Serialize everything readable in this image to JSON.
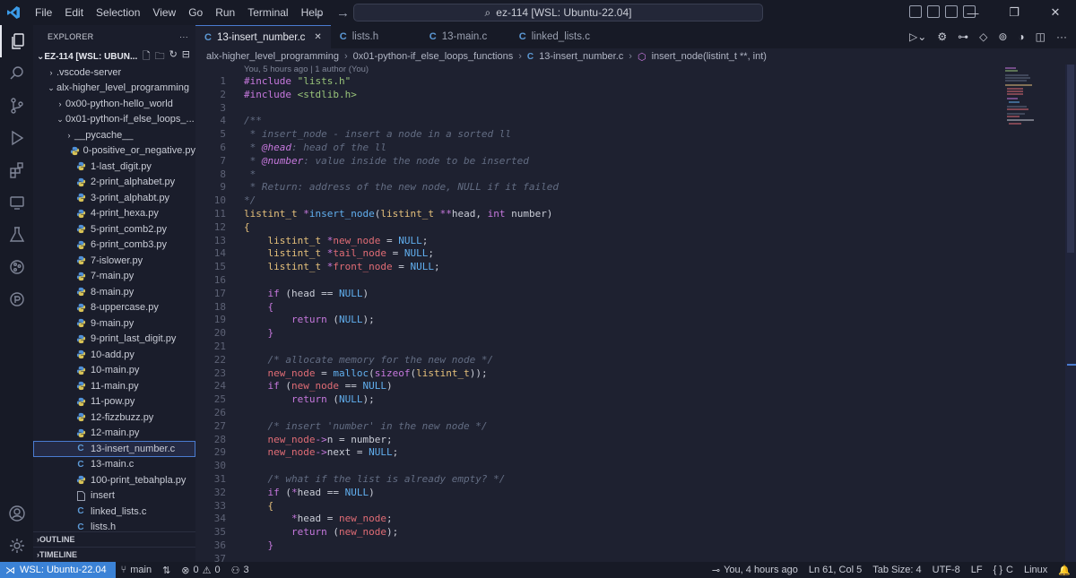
{
  "titlebar": {
    "menu": [
      "File",
      "Edit",
      "Selection",
      "View",
      "Go",
      "Run",
      "Terminal",
      "Help"
    ],
    "command_center": "ez-114 [WSL: Ubuntu-22.04]"
  },
  "sidebar": {
    "title": "EXPLORER",
    "workspace": "EZ-114 [WSL: UBUN...",
    "items": [
      {
        "label": ".vscode-server",
        "kind": "folder",
        "depth": 1,
        "open": false
      },
      {
        "label": "alx-higher_level_programming",
        "kind": "folder",
        "depth": 1,
        "open": true
      },
      {
        "label": "0x00-python-hello_world",
        "kind": "folder",
        "depth": 2,
        "open": false
      },
      {
        "label": "0x01-python-if_else_loops_...",
        "kind": "folder",
        "depth": 2,
        "open": true
      },
      {
        "label": "__pycache__",
        "kind": "folder",
        "depth": 3,
        "open": false
      },
      {
        "label": "0-positive_or_negative.py",
        "kind": "py",
        "depth": 3
      },
      {
        "label": "1-last_digit.py",
        "kind": "py",
        "depth": 3
      },
      {
        "label": "2-print_alphabet.py",
        "kind": "py",
        "depth": 3
      },
      {
        "label": "3-print_alphabt.py",
        "kind": "py",
        "depth": 3
      },
      {
        "label": "4-print_hexa.py",
        "kind": "py",
        "depth": 3
      },
      {
        "label": "5-print_comb2.py",
        "kind": "py",
        "depth": 3
      },
      {
        "label": "6-print_comb3.py",
        "kind": "py",
        "depth": 3
      },
      {
        "label": "7-islower.py",
        "kind": "py",
        "depth": 3
      },
      {
        "label": "7-main.py",
        "kind": "py",
        "depth": 3
      },
      {
        "label": "8-main.py",
        "kind": "py",
        "depth": 3
      },
      {
        "label": "8-uppercase.py",
        "kind": "py",
        "depth": 3
      },
      {
        "label": "9-main.py",
        "kind": "py",
        "depth": 3
      },
      {
        "label": "9-print_last_digit.py",
        "kind": "py",
        "depth": 3
      },
      {
        "label": "10-add.py",
        "kind": "py",
        "depth": 3
      },
      {
        "label": "10-main.py",
        "kind": "py",
        "depth": 3
      },
      {
        "label": "11-main.py",
        "kind": "py",
        "depth": 3
      },
      {
        "label": "11-pow.py",
        "kind": "py",
        "depth": 3
      },
      {
        "label": "12-fizzbuzz.py",
        "kind": "py",
        "depth": 3
      },
      {
        "label": "12-main.py",
        "kind": "py",
        "depth": 3
      },
      {
        "label": "13-insert_number.c",
        "kind": "c",
        "depth": 3,
        "selected": true
      },
      {
        "label": "13-main.c",
        "kind": "c",
        "depth": 3
      },
      {
        "label": "100-print_tebahpla.py",
        "kind": "py",
        "depth": 3
      },
      {
        "label": "insert",
        "kind": "file",
        "depth": 3
      },
      {
        "label": "linked_lists.c",
        "kind": "c",
        "depth": 3
      },
      {
        "label": "lists.h",
        "kind": "c",
        "depth": 3
      }
    ],
    "outline_label": "OUTLINE",
    "timeline_label": "TIMELINE"
  },
  "tabs": [
    {
      "label": "13-insert_number.c",
      "active": true
    },
    {
      "label": "lists.h",
      "active": false
    },
    {
      "label": "13-main.c",
      "active": false
    },
    {
      "label": "linked_lists.c",
      "active": false
    }
  ],
  "breadcrumb": {
    "parts": [
      "alx-higher_level_programming",
      "0x01-python-if_else_loops_functions",
      "13-insert_number.c"
    ],
    "symbol": "insert_node(listint_t **, int)"
  },
  "editor": {
    "blame_header": "You, 5 hours ago | 1 author (You)",
    "lines": [
      {
        "n": "1",
        "html": "<span class=\"k-pre\">#include</span> <span class=\"k-str\">\"lists.h\"</span>"
      },
      {
        "n": "2",
        "html": "<span class=\"k-pre\">#include</span> <span class=\"k-str\">&lt;stdlib.h&gt;</span>"
      },
      {
        "n": "3",
        "html": ""
      },
      {
        "n": "4",
        "html": "<span class=\"k-com\">/**</span>"
      },
      {
        "n": "5",
        "html": "<span class=\"k-com\"> * insert_node - insert a node in a sorted ll</span>"
      },
      {
        "n": "6",
        "html": "<span class=\"k-com\"> * </span><span class=\"k-doc\">@head</span><span class=\"k-com\">: head of the ll</span>"
      },
      {
        "n": "7",
        "html": "<span class=\"k-com\"> * </span><span class=\"k-doc\">@number</span><span class=\"k-com\">: value inside the node to be inserted</span>"
      },
      {
        "n": "8",
        "html": "<span class=\"k-com\"> *</span>"
      },
      {
        "n": "9",
        "html": "<span class=\"k-com\"> * Return: address of the new node, NULL if it failed</span>"
      },
      {
        "n": "10",
        "html": "<span class=\"k-com\">*/</span>"
      },
      {
        "n": "11",
        "html": "<span class=\"k-type\">listint_t</span> <span class=\"k-kw\">*</span><span class=\"k-null\">insert_node</span>(<span class=\"k-type\">listint_t</span> <span class=\"k-kw\">**</span>head, <span class=\"k-kw\">int</span> number)"
      },
      {
        "n": "12",
        "html": "<span class=\"k-fn\">{</span>"
      },
      {
        "n": "13",
        "html": "    <span class=\"k-type\">listint_t</span> <span class=\"k-kw\">*</span><span class=\"k-var\">new_node</span> = <span class=\"k-null\">NULL</span>;"
      },
      {
        "n": "14",
        "html": "    <span class=\"k-type\">listint_t</span> <span class=\"k-kw\">*</span><span class=\"k-var\">tail_node</span> = <span class=\"k-null\">NULL</span>;"
      },
      {
        "n": "15",
        "html": "    <span class=\"k-type\">listint_t</span> <span class=\"k-kw\">*</span><span class=\"k-var\">front_node</span> = <span class=\"k-null\">NULL</span>;"
      },
      {
        "n": "16",
        "html": ""
      },
      {
        "n": "17",
        "html": "    <span class=\"k-kw\">if</span> (head == <span class=\"k-null\">NULL</span>)"
      },
      {
        "n": "18",
        "html": "    <span class=\"k-kw\">{</span>"
      },
      {
        "n": "19",
        "html": "        <span class=\"k-kw\">return</span> (<span class=\"k-null\">NULL</span>);"
      },
      {
        "n": "20",
        "html": "    <span class=\"k-kw\">}</span>"
      },
      {
        "n": "21",
        "html": ""
      },
      {
        "n": "22",
        "html": "    <span class=\"k-com\">/* allocate memory for the new node */</span>"
      },
      {
        "n": "23",
        "html": "    <span class=\"k-var\">new_node</span> = <span class=\"k-null\">malloc</span>(<span class=\"k-kw\">sizeof</span>(<span class=\"k-type\">listint_t</span>));"
      },
      {
        "n": "24",
        "html": "    <span class=\"k-kw\">if</span> (<span class=\"k-var\">new_node</span> == <span class=\"k-null\">NULL</span>)"
      },
      {
        "n": "25",
        "html": "        <span class=\"k-kw\">return</span> (<span class=\"k-null\">NULL</span>);"
      },
      {
        "n": "26",
        "html": ""
      },
      {
        "n": "27",
        "html": "    <span class=\"k-com\">/* insert 'number' in the new node */</span>"
      },
      {
        "n": "28",
        "html": "    <span class=\"k-var\">new_node</span><span class=\"k-kw\">-&gt;</span>n = number;"
      },
      {
        "n": "29",
        "html": "    <span class=\"k-var\">new_node</span><span class=\"k-kw\">-&gt;</span>next = <span class=\"k-null\">NULL</span>;"
      },
      {
        "n": "30",
        "html": ""
      },
      {
        "n": "31",
        "html": "    <span class=\"k-com\">/* what if the list is already empty? */</span>"
      },
      {
        "n": "32",
        "html": "    <span class=\"k-kw\">if</span> (<span class=\"k-kw\">*</span>head == <span class=\"k-null\">NULL</span>)"
      },
      {
        "n": "33",
        "html": "    <span class=\"k-fn\">{</span>"
      },
      {
        "n": "34",
        "html": "        <span class=\"k-kw\">*</span>head = <span class=\"k-var\">new_node</span>;"
      },
      {
        "n": "35",
        "html": "        <span class=\"k-kw\">return</span> (<span class=\"k-var\">new_node</span>);"
      },
      {
        "n": "36",
        "html": "    <span class=\"k-kw\">}</span>"
      },
      {
        "n": "37",
        "html": ""
      }
    ]
  },
  "statusbar": {
    "remote": "WSL: Ubuntu-22.04",
    "branch": "main",
    "errors": "0",
    "warnings": "0",
    "ports": "3",
    "blame": "You, 4 hours ago",
    "position": "Ln 61, Col 5",
    "tab_size": "Tab Size: 4",
    "encoding": "UTF-8",
    "eol": "LF",
    "language": "C",
    "platform": "Linux"
  },
  "colors": {
    "accent": "#3b82d6",
    "background": "#1e2130",
    "sidebar": "#1a1d2b"
  }
}
